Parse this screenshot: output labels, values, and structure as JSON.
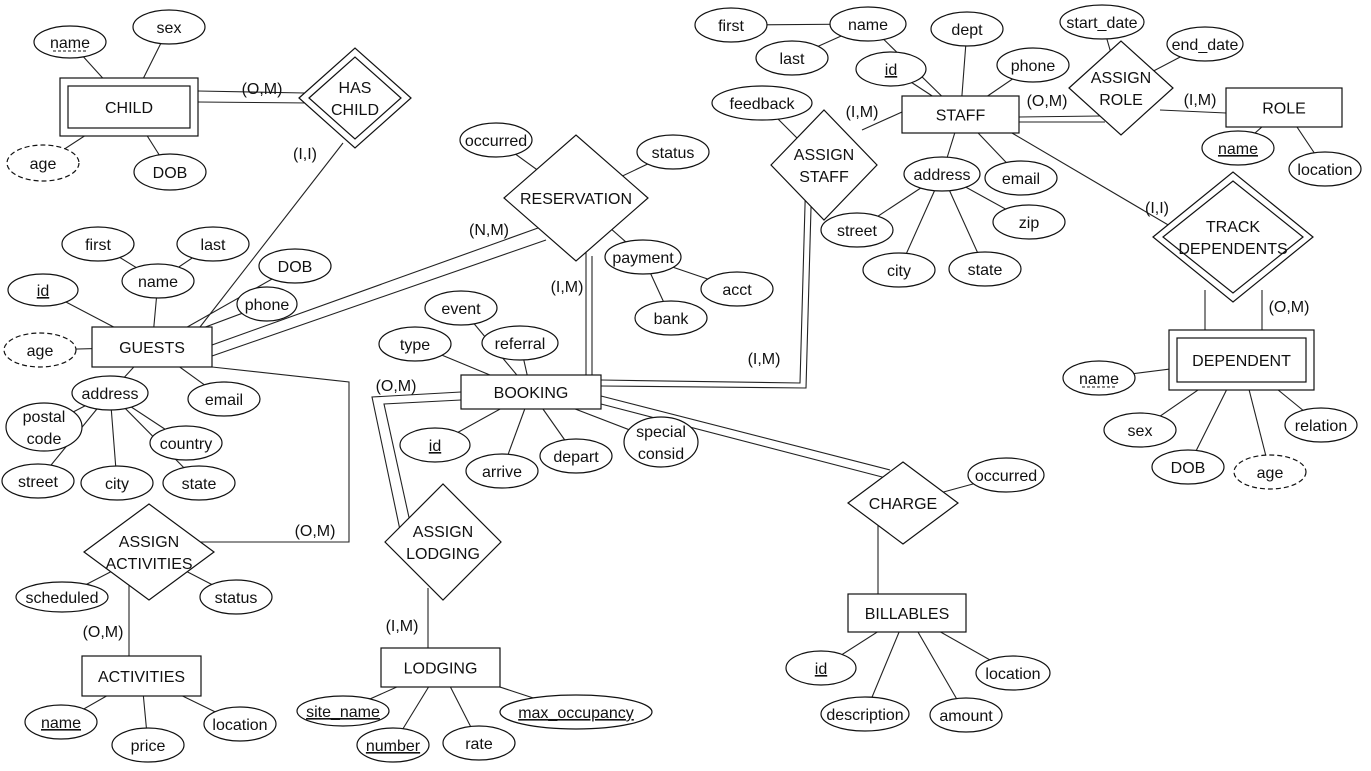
{
  "entities": [
    {
      "id": "child",
      "label": "CHILD",
      "weak": true
    },
    {
      "id": "guests",
      "label": "GUESTS",
      "weak": false
    },
    {
      "id": "booking",
      "label": "BOOKING",
      "weak": false
    },
    {
      "id": "staff",
      "label": "STAFF",
      "weak": false
    },
    {
      "id": "role",
      "label": "ROLE",
      "weak": false
    },
    {
      "id": "dependent",
      "label": "DEPENDENT",
      "weak": true
    },
    {
      "id": "activities",
      "label": "ACTIVITIES",
      "weak": false
    },
    {
      "id": "lodging",
      "label": "LODGING",
      "weak": false
    },
    {
      "id": "billables",
      "label": "BILLABLES",
      "weak": false
    }
  ],
  "relationships": [
    {
      "id": "has_child",
      "label_lines": [
        "HAS",
        "CHILD"
      ],
      "identifying": true
    },
    {
      "id": "reservation",
      "label_lines": [
        "RESERVATION"
      ],
      "identifying": false
    },
    {
      "id": "assign_staff",
      "label_lines": [
        "ASSIGN",
        "STAFF"
      ],
      "identifying": false
    },
    {
      "id": "assign_role",
      "label_lines": [
        "ASSIGN",
        "ROLE"
      ],
      "identifying": false
    },
    {
      "id": "track_dependents",
      "label_lines": [
        "TRACK",
        "DEPENDENTS"
      ],
      "identifying": true
    },
    {
      "id": "assign_activities",
      "label_lines": [
        "ASSIGN",
        "ACTIVITIES"
      ],
      "identifying": false
    },
    {
      "id": "assign_lodging",
      "label_lines": [
        "ASSIGN",
        "LODGING"
      ],
      "identifying": false
    },
    {
      "id": "charge",
      "label_lines": [
        "CHARGE"
      ],
      "identifying": false
    }
  ],
  "attributes": [
    {
      "id": "child_name",
      "owner": "child",
      "label_lines": [
        "name"
      ],
      "key": "partial"
    },
    {
      "id": "child_sex",
      "owner": "child",
      "label_lines": [
        "sex"
      ]
    },
    {
      "id": "child_age",
      "owner": "child",
      "label_lines": [
        "age"
      ],
      "derived": true
    },
    {
      "id": "child_dob",
      "owner": "child",
      "label_lines": [
        "DOB"
      ]
    },
    {
      "id": "g_id",
      "owner": "guests",
      "label_lines": [
        "id"
      ],
      "key": "primary"
    },
    {
      "id": "g_name",
      "owner": "guests",
      "label_lines": [
        "name"
      ]
    },
    {
      "id": "g_first",
      "owner": "g_name",
      "label_lines": [
        "first"
      ]
    },
    {
      "id": "g_last",
      "owner": "g_name",
      "label_lines": [
        "last"
      ]
    },
    {
      "id": "g_dob",
      "owner": "guests",
      "label_lines": [
        "DOB"
      ]
    },
    {
      "id": "g_phone",
      "owner": "guests",
      "label_lines": [
        "phone"
      ]
    },
    {
      "id": "g_age",
      "owner": "guests",
      "label_lines": [
        "age"
      ],
      "derived": true
    },
    {
      "id": "g_address",
      "owner": "guests",
      "label_lines": [
        "address"
      ]
    },
    {
      "id": "g_email",
      "owner": "guests",
      "label_lines": [
        "email"
      ]
    },
    {
      "id": "g_postal",
      "owner": "g_address",
      "label_lines": [
        "postal",
        "code"
      ]
    },
    {
      "id": "g_country",
      "owner": "g_address",
      "label_lines": [
        "country"
      ]
    },
    {
      "id": "g_street",
      "owner": "g_address",
      "label_lines": [
        "street"
      ]
    },
    {
      "id": "g_city",
      "owner": "g_address",
      "label_lines": [
        "city"
      ]
    },
    {
      "id": "g_state",
      "owner": "g_address",
      "label_lines": [
        "state"
      ]
    },
    {
      "id": "r_occurred",
      "owner": "reservation",
      "label_lines": [
        "occurred"
      ]
    },
    {
      "id": "r_status",
      "owner": "reservation",
      "label_lines": [
        "status"
      ]
    },
    {
      "id": "r_payment",
      "owner": "reservation",
      "label_lines": [
        "payment"
      ]
    },
    {
      "id": "r_acct",
      "owner": "r_payment",
      "label_lines": [
        "acct"
      ]
    },
    {
      "id": "r_bank",
      "owner": "r_payment",
      "label_lines": [
        "bank"
      ]
    },
    {
      "id": "b_event",
      "owner": "booking",
      "label_lines": [
        "event"
      ]
    },
    {
      "id": "b_type",
      "owner": "booking",
      "label_lines": [
        "type"
      ]
    },
    {
      "id": "b_referral",
      "owner": "booking",
      "label_lines": [
        "referral"
      ]
    },
    {
      "id": "b_id",
      "owner": "booking",
      "label_lines": [
        "id"
      ],
      "key": "primary"
    },
    {
      "id": "b_arrive",
      "owner": "booking",
      "label_lines": [
        "arrive"
      ]
    },
    {
      "id": "b_depart",
      "owner": "booking",
      "label_lines": [
        "depart"
      ]
    },
    {
      "id": "b_special",
      "owner": "booking",
      "label_lines": [
        "special",
        "consid"
      ]
    },
    {
      "id": "s_name",
      "owner": "staff",
      "label_lines": [
        "name"
      ]
    },
    {
      "id": "s_first",
      "owner": "s_name",
      "label_lines": [
        "first"
      ]
    },
    {
      "id": "s_last",
      "owner": "s_name",
      "label_lines": [
        "last"
      ]
    },
    {
      "id": "s_dept",
      "owner": "staff",
      "label_lines": [
        "dept"
      ]
    },
    {
      "id": "s_id",
      "owner": "staff",
      "label_lines": [
        "id"
      ],
      "key": "primary"
    },
    {
      "id": "s_phone",
      "owner": "staff",
      "label_lines": [
        "phone"
      ]
    },
    {
      "id": "s_feedback",
      "owner": "assign_staff",
      "label_lines": [
        "feedback"
      ]
    },
    {
      "id": "s_address",
      "owner": "staff",
      "label_lines": [
        "address"
      ]
    },
    {
      "id": "s_email",
      "owner": "staff",
      "label_lines": [
        "email"
      ]
    },
    {
      "id": "s_street",
      "owner": "s_address",
      "label_lines": [
        "street"
      ]
    },
    {
      "id": "s_zip",
      "owner": "s_address",
      "label_lines": [
        "zip"
      ]
    },
    {
      "id": "s_city",
      "owner": "s_address",
      "label_lines": [
        "city"
      ]
    },
    {
      "id": "s_state",
      "owner": "s_address",
      "label_lines": [
        "state"
      ]
    },
    {
      "id": "ar_start",
      "owner": "assign_role",
      "label_lines": [
        "start_date"
      ]
    },
    {
      "id": "ar_end",
      "owner": "assign_role",
      "label_lines": [
        "end_date"
      ]
    },
    {
      "id": "ro_name",
      "owner": "role",
      "label_lines": [
        "name"
      ],
      "key": "primary"
    },
    {
      "id": "ro_location",
      "owner": "role",
      "label_lines": [
        "location"
      ]
    },
    {
      "id": "d_name",
      "owner": "dependent",
      "label_lines": [
        "name"
      ],
      "key": "partial"
    },
    {
      "id": "d_sex",
      "owner": "dependent",
      "label_lines": [
        "sex"
      ]
    },
    {
      "id": "d_dob",
      "owner": "dependent",
      "label_lines": [
        "DOB"
      ]
    },
    {
      "id": "d_age",
      "owner": "dependent",
      "label_lines": [
        "age"
      ],
      "derived": true
    },
    {
      "id": "d_relation",
      "owner": "dependent",
      "label_lines": [
        "relation"
      ]
    },
    {
      "id": "aa_scheduled",
      "owner": "assign_activities",
      "label_lines": [
        "scheduled"
      ]
    },
    {
      "id": "aa_status",
      "owner": "assign_activities",
      "label_lines": [
        "status"
      ],
      "bold": true
    },
    {
      "id": "a_name",
      "owner": "activities",
      "label_lines": [
        "name"
      ],
      "key": "primary"
    },
    {
      "id": "a_price",
      "owner": "activities",
      "label_lines": [
        "price"
      ]
    },
    {
      "id": "a_location",
      "owner": "activities",
      "label_lines": [
        "location"
      ]
    },
    {
      "id": "l_site",
      "owner": "lodging",
      "label_lines": [
        "site_name"
      ],
      "key": "primary"
    },
    {
      "id": "l_number",
      "owner": "lodging",
      "label_lines": [
        "number"
      ],
      "key": "primary"
    },
    {
      "id": "l_rate",
      "owner": "lodging",
      "label_lines": [
        "rate"
      ]
    },
    {
      "id": "l_max",
      "owner": "lodging",
      "label_lines": [
        "max_occupancy"
      ],
      "key": "primary"
    },
    {
      "id": "c_occurred",
      "owner": "charge",
      "label_lines": [
        "occurred"
      ]
    },
    {
      "id": "bi_id",
      "owner": "billables",
      "label_lines": [
        "id"
      ],
      "key": "primary"
    },
    {
      "id": "bi_desc",
      "owner": "billables",
      "label_lines": [
        "description"
      ]
    },
    {
      "id": "bi_amount",
      "owner": "billables",
      "label_lines": [
        "amount"
      ]
    },
    {
      "id": "bi_location",
      "owner": "billables",
      "label_lines": [
        "location"
      ]
    }
  ],
  "connections": [
    {
      "id": "c1",
      "from": "child",
      "to": "has_child",
      "cardinality": "(O,M)",
      "total": true
    },
    {
      "id": "c2",
      "from": "has_child",
      "to": "guests",
      "cardinality": "(I,I)",
      "total": false
    },
    {
      "id": "c3",
      "from": "guests",
      "to": "reservation",
      "cardinality": "(N,M)",
      "total": true
    },
    {
      "id": "c4",
      "from": "reservation",
      "to": "booking",
      "cardinality": "(I,M)",
      "total": true
    },
    {
      "id": "c5",
      "from": "booking",
      "to": "assign_staff",
      "cardinality": "(I,M)",
      "total": true
    },
    {
      "id": "c6",
      "from": "assign_staff",
      "to": "staff",
      "cardinality": "(I,M)",
      "total": false
    },
    {
      "id": "c7",
      "from": "staff",
      "to": "assign_role",
      "cardinality": "(O,M)",
      "total": true
    },
    {
      "id": "c8",
      "from": "assign_role",
      "to": "role",
      "cardinality": "(I,M)",
      "total": false
    },
    {
      "id": "c9",
      "from": "staff",
      "to": "track_dependents",
      "cardinality": "(I,I)",
      "total": false
    },
    {
      "id": "c10",
      "from": "track_dependents",
      "to": "dependent",
      "cardinality": "(O,M)",
      "total": true
    },
    {
      "id": "c11",
      "from": "guests",
      "to": "assign_activities",
      "cardinality": "(O,M)",
      "total": false
    },
    {
      "id": "c12",
      "from": "assign_activities",
      "to": "activities",
      "cardinality": "(O,M)",
      "total": false
    },
    {
      "id": "c13",
      "from": "booking",
      "to": "assign_lodging",
      "cardinality": "(O,M)",
      "total": true
    },
    {
      "id": "c14",
      "from": "assign_lodging",
      "to": "lodging",
      "cardinality": "(I,M)",
      "total": false
    },
    {
      "id": "c15",
      "from": "booking",
      "to": "charge",
      "cardinality": "",
      "total": true
    },
    {
      "id": "c16",
      "from": "charge",
      "to": "billables",
      "cardinality": "",
      "total": false
    }
  ]
}
